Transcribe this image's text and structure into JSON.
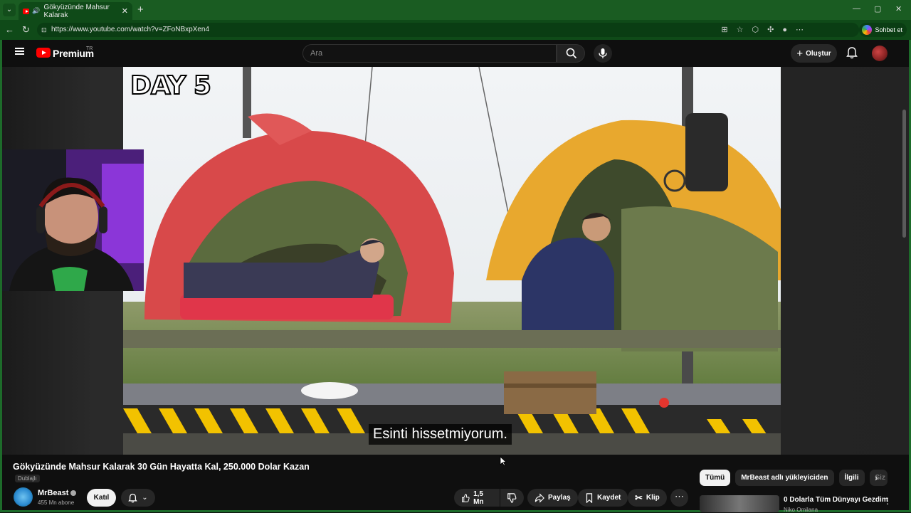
{
  "browser": {
    "tab_title": "Gökyüzünde Mahsur Kalarak",
    "tab_close": "✕",
    "new_tab": "+",
    "url": "https://www.youtube.com/watch?v=ZFoNBxpXen4",
    "copilot_label": "Sohbet et",
    "window_controls": [
      "—",
      "▢",
      "✕"
    ]
  },
  "youtube": {
    "brand": "Premium",
    "brand_region": "TR",
    "search_placeholder": "Ara",
    "create_label": "Oluştur",
    "create_icon": "+"
  },
  "video": {
    "overlay_text": "DAY 5",
    "subtitle": "Esinti hissetmiyorum.",
    "title": "Gökyüzünde Mahsur Kalarak 30 Gün Hayatta Kal, 250.000 Dolar Kazan",
    "dubbed_badge": "Dublajlı"
  },
  "channel": {
    "name": "MrBeast",
    "subscribers": "455 Mn abone",
    "join_label": "Katıl"
  },
  "actions": {
    "likes": "1,5 Mn",
    "share": "Paylaş",
    "save": "Kaydet",
    "clip": "Klip",
    "more": "⋯"
  },
  "chips": [
    "Tümü",
    "MrBeast adlı yükleyiciden",
    "İlgili",
    "Siz"
  ],
  "recommendation": {
    "title": "0 Dolarla Tüm Dünyayı Gezdim",
    "channel": "Niko Omilana"
  },
  "colors": {
    "chrome_green": "#1a5c22",
    "youtube_red": "#ff0000",
    "page_bg": "#0f0f0f"
  }
}
